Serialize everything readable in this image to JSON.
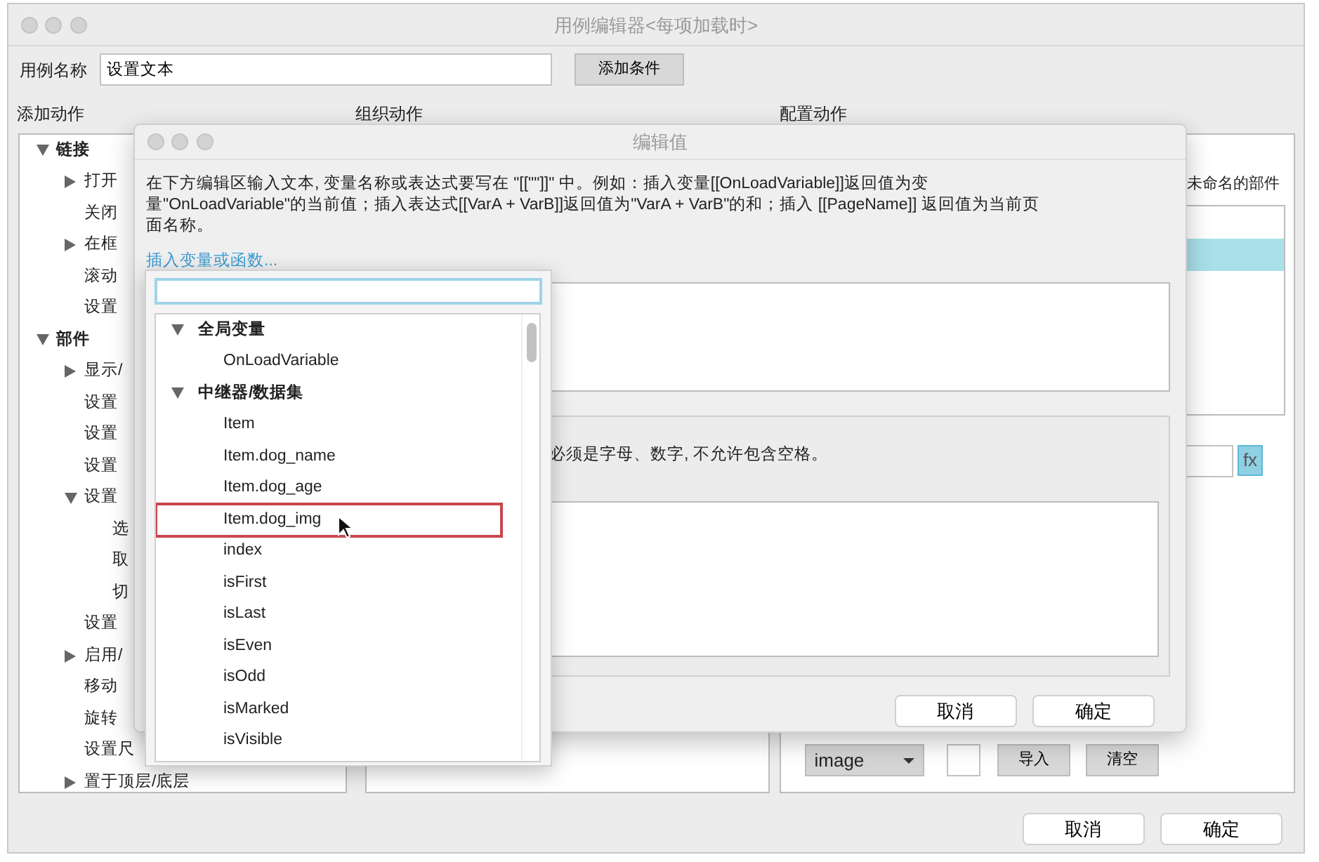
{
  "window": {
    "title": "用例编辑器<每项加载时>"
  },
  "case_name": {
    "label": "用例名称",
    "value": "设置文本"
  },
  "add_condition_button": "添加条件",
  "sections": [
    "添加动作",
    "组织动作",
    "配置动作"
  ],
  "action_tree": [
    {
      "label": "链接",
      "expanded": true,
      "children": [
        {
          "label": "打开",
          "expanded": false
        },
        {
          "label": "关闭"
        },
        {
          "label": "在框",
          "expanded": false
        },
        {
          "label": "滚动"
        },
        {
          "label": "设置"
        }
      ]
    },
    {
      "label": "部件",
      "expanded": true,
      "children": [
        {
          "label": "显示/",
          "expanded": false
        },
        {
          "label": "设置"
        },
        {
          "label": "设置"
        },
        {
          "label": "设置"
        },
        {
          "label": "设置",
          "expanded": true,
          "children": [
            {
              "label": "选"
            },
            {
              "label": "取"
            },
            {
              "label": "切"
            }
          ]
        },
        {
          "label": "设置"
        },
        {
          "label": "启用/",
          "expanded": false
        },
        {
          "label": "移动"
        },
        {
          "label": "旋转"
        },
        {
          "label": "设置尺"
        },
        {
          "label": "置于顶层/底层",
          "expanded": false
        }
      ]
    }
  ],
  "config": {
    "widget_label": "未命名的部件",
    "rows": [
      {
        "selected": true
      }
    ],
    "fx_button": {
      "label": "fx",
      "highlighted": true
    },
    "type_select": "image",
    "import_button": "导入",
    "clear_button": "清空"
  },
  "buttons": [
    "取消",
    "确定"
  ],
  "dialog": {
    "title": "编辑值",
    "instructions": "在下方编辑区输入文本, 变量名称或表达式要写在 \"[[\"\"]]\" 中。例如：插入变量[[OnLoadVariable]]返回值为变量\"OnLoadVariable\"的当前值；插入表达式[[VarA + VarB]]返回值为\"VarA + VarB\"的和；插入 [[PageName]] 返回值为当前页面名称。",
    "insert_link": "插入变量或函数...",
    "name_hint": "必须是字母、数字, 不允许包含空格。",
    "buttons": [
      "取消",
      "确定"
    ]
  },
  "variable_menu": {
    "tree": [
      {
        "label": "全局变量",
        "expanded": true,
        "children": [
          {
            "label": "OnLoadVariable",
            "selected": false
          }
        ]
      },
      {
        "label": "中继器/数据集",
        "expanded": true,
        "children": [
          {
            "label": "Item",
            "selected": false
          },
          {
            "label": "Item.dog_name",
            "selected": false
          },
          {
            "label": "Item.dog_age",
            "selected": false
          },
          {
            "label": "Item.dog_img",
            "selected": true
          },
          {
            "label": "index",
            "selected": false
          },
          {
            "label": "isFirst",
            "selected": false
          },
          {
            "label": "isLast",
            "selected": false
          },
          {
            "label": "isEven",
            "selected": false
          },
          {
            "label": "isOdd",
            "selected": false
          },
          {
            "label": "isMarked",
            "selected": false
          },
          {
            "label": "isVisible",
            "selected": false
          }
        ]
      }
    ]
  }
}
